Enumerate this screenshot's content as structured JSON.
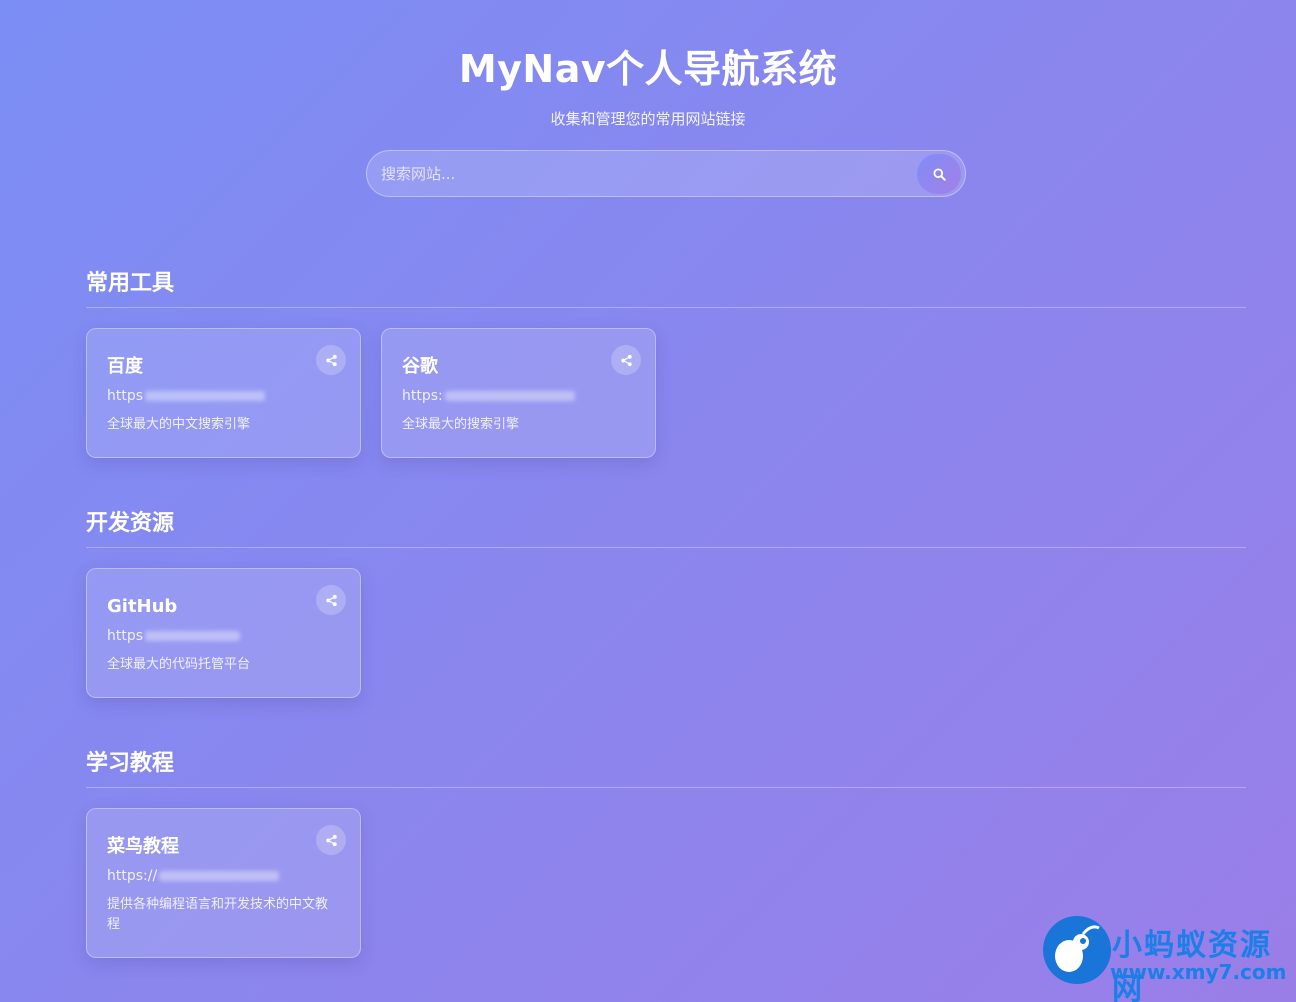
{
  "header": {
    "title": "MyNav个人导航系统",
    "subtitle": "收集和管理您的常用网站链接"
  },
  "search": {
    "placeholder": "搜索网站...",
    "icon": "search-icon"
  },
  "sections": [
    {
      "title": "常用工具",
      "cards": [
        {
          "name": "百度",
          "url_prefix": "https",
          "description": "全球最大的中文搜索引擎"
        },
        {
          "name": "谷歌",
          "url_prefix": "https:",
          "description": "全球最大的搜索引擎"
        }
      ]
    },
    {
      "title": "开发资源",
      "cards": [
        {
          "name": "GitHub",
          "url_prefix": "https",
          "description": "全球最大的代码托管平台"
        }
      ]
    },
    {
      "title": "学习教程",
      "cards": [
        {
          "name": "菜鸟教程",
          "url_prefix": "https://",
          "description": "提供各种编程语言和开发技术的中文教程"
        }
      ]
    }
  ],
  "watermark": {
    "brand": "小蚂蚁资源网",
    "site": "www.xmy7.com"
  }
}
